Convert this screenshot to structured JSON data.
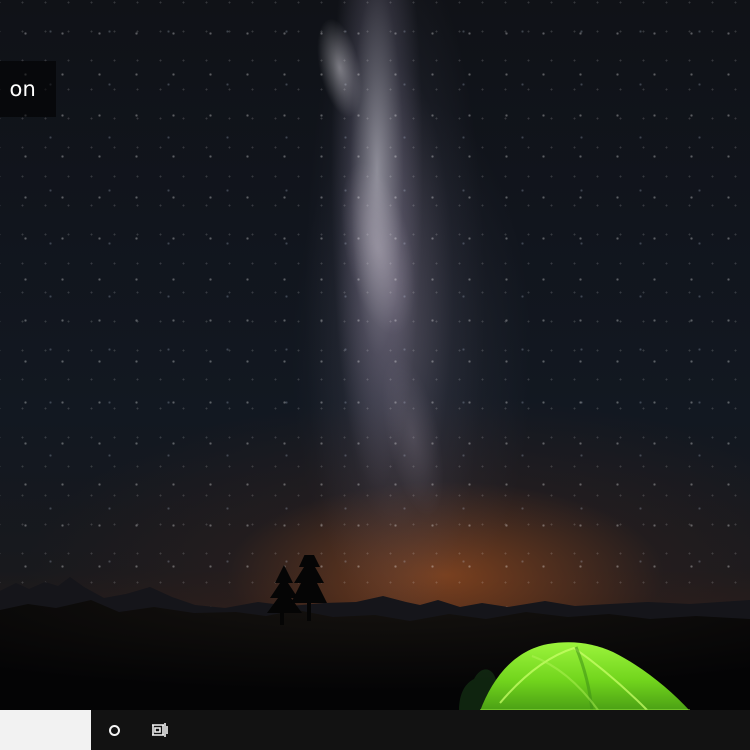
{
  "desktop": {
    "wallpaper_name": "night-sky-camping-wallpaper",
    "sign_in_partial_text": "on"
  },
  "taskbar": {
    "search_placeholder": "",
    "cortana_icon": "cortana-circle-icon",
    "task_view_icon": "task-view-icon",
    "background_color": "#121212",
    "search_box_color": "#f2f2f2"
  },
  "colors": {
    "tent_green": "#72d51d",
    "horizon_orange": "#ff741f"
  }
}
